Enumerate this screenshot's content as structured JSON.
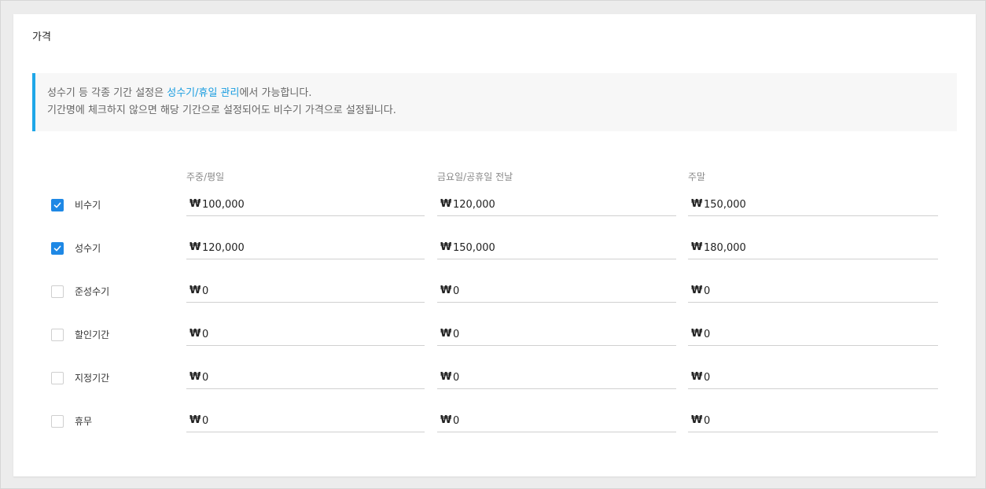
{
  "section": {
    "title": "가격"
  },
  "notice": {
    "line1_prefix": "성수기 등 각종 기간 설정은 ",
    "line1_link": "성수기/휴일 관리",
    "line1_suffix": "에서 가능합니다.",
    "line2": "기간명에 체크하지 않으면 해당 기간으로 설정되어도 비수기 가격으로 설정됩니다."
  },
  "columns": [
    "주중/평일",
    "금요일/공휴일 전날",
    "주말"
  ],
  "currency_symbol": "₩",
  "rows": [
    {
      "label": "비수기",
      "checked": true,
      "prices": [
        "100,000",
        "120,000",
        "150,000"
      ]
    },
    {
      "label": "성수기",
      "checked": true,
      "prices": [
        "120,000",
        "150,000",
        "180,000"
      ]
    },
    {
      "label": "준성수기",
      "checked": false,
      "prices": [
        "0",
        "0",
        "0"
      ]
    },
    {
      "label": "할인기간",
      "checked": false,
      "prices": [
        "0",
        "0",
        "0"
      ]
    },
    {
      "label": "지정기간",
      "checked": false,
      "prices": [
        "0",
        "0",
        "0"
      ]
    },
    {
      "label": "휴무",
      "checked": false,
      "prices": [
        "0",
        "0",
        "0"
      ]
    }
  ],
  "colors": {
    "accent": "#1fa7e8",
    "checkbox_checked": "#1e88e5",
    "link": "#1a9de0"
  }
}
